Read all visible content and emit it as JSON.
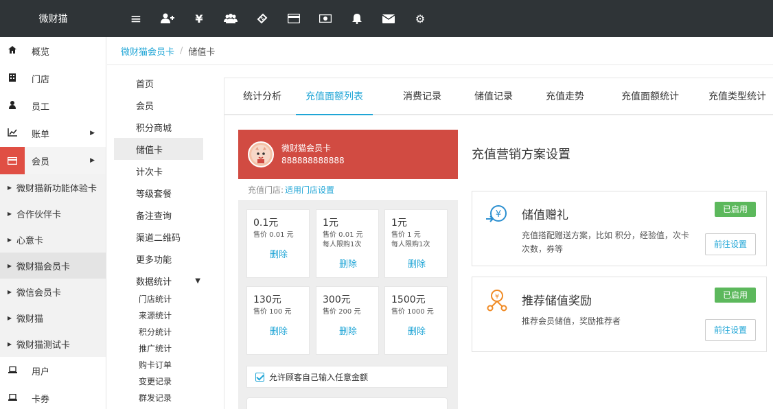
{
  "app": {
    "brand": "微财猫"
  },
  "topbar": {
    "icons": [
      {
        "name": "menu-icon",
        "glyph": "≡"
      },
      {
        "name": "add-user-icon",
        "glyph": "👤"
      },
      {
        "name": "yen-icon",
        "glyph": "¥"
      },
      {
        "name": "users-icon",
        "glyph": "👥"
      },
      {
        "name": "ticket-icon",
        "glyph": "🎟"
      },
      {
        "name": "credit-card-icon",
        "glyph": "▭"
      },
      {
        "name": "money-icon",
        "glyph": "◙"
      },
      {
        "name": "bell-icon",
        "glyph": "🔔"
      },
      {
        "name": "envelope-icon",
        "glyph": "✉"
      },
      {
        "name": "gear-icon",
        "glyph": "⚙"
      }
    ]
  },
  "sidebar": {
    "items": [
      {
        "label": "概览",
        "icon": "home-icon",
        "glyph": "⌂"
      },
      {
        "label": "门店",
        "icon": "building-icon",
        "glyph": "▥"
      },
      {
        "label": "员工",
        "icon": "user-icon",
        "glyph": "●"
      },
      {
        "label": "账单",
        "icon": "line-chart-icon",
        "glyph": "⟋"
      },
      {
        "label": "会员",
        "icon": "card-icon",
        "glyph": "▭"
      }
    ],
    "subitems": [
      "微财猫新功能体验卡",
      "合作伙伴卡",
      "心意卡",
      "微财猫会员卡",
      "微信会员卡",
      "微财猫",
      "微财猫测试卡"
    ],
    "bottom_items": [
      {
        "label": "用户",
        "icon": "laptop-icon",
        "glyph": "▭"
      },
      {
        "label": "卡券",
        "icon": "laptop-icon",
        "glyph": "▭"
      }
    ]
  },
  "breadcrumb": {
    "parent": "微财猫会员卡",
    "separator": "/",
    "current": "储值卡"
  },
  "submenu": {
    "items": [
      "首页",
      "会员",
      "积分商城",
      "储值卡",
      "计次卡",
      "等级套餐",
      "备注查询",
      "渠道二维码",
      "更多功能",
      "数据统计"
    ],
    "stats_children": [
      "门店统计",
      "来源统计",
      "积分统计",
      "推广统计",
      "购卡订单",
      "变更记录",
      "群发记录"
    ]
  },
  "tabs": [
    "统计分析",
    "充值面额列表",
    "消费记录",
    "储值记录",
    "充值走势",
    "充值面额统计",
    "充值类型统计"
  ],
  "card": {
    "name": "微财猫会员卡",
    "number": "888888888888",
    "store_label": "充值门店:",
    "store_link": "适用门店设置",
    "amounts": [
      {
        "value": "0.1元",
        "price": "售价 0.01 元",
        "limit": "",
        "delete": "删除"
      },
      {
        "value": "1元",
        "price": "售价 0.01 元",
        "limit": "每人限购1次",
        "delete": "删除"
      },
      {
        "value": "1元",
        "price": "售价 1 元",
        "limit": "每人限购1次",
        "delete": "删除"
      },
      {
        "value": "130元",
        "price": "售价 100 元",
        "limit": "",
        "delete": "删除"
      },
      {
        "value": "300元",
        "price": "售价 200 元",
        "limit": "",
        "delete": "删除"
      },
      {
        "value": "1500元",
        "price": "售价 1000 元",
        "limit": "",
        "delete": "删除"
      }
    ],
    "allow_custom": "允许顾客自己输入任意金额"
  },
  "settings": {
    "title": "充值营销方案设置",
    "boxes": [
      {
        "title": "储值赠礼",
        "desc": "充值搭配赠送方案，比如 积分，经验值，次卡次数，券等",
        "badge": "已启用",
        "button": "前往设置"
      },
      {
        "title": "推荐储值奖励",
        "desc": "推荐会员储值，奖励推荐者",
        "badge": "已启用",
        "button": "前往设置"
      }
    ]
  }
}
